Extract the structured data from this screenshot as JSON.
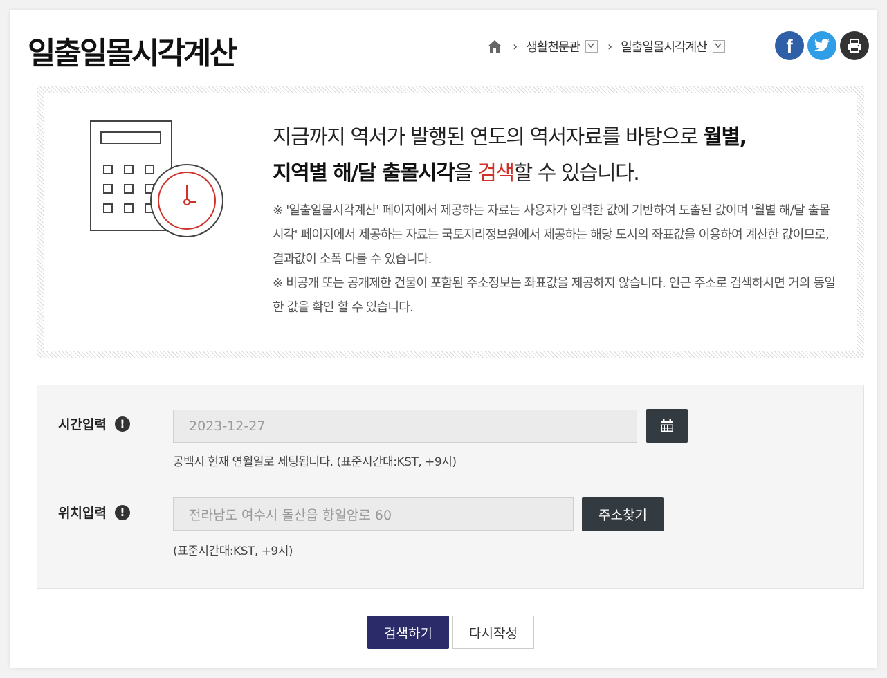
{
  "page": {
    "title": "일출일몰시각계산"
  },
  "breadcrumb": {
    "home_icon": "home-icon",
    "items": [
      {
        "label": "생활천문관"
      },
      {
        "label": "일출일몰시각계산"
      }
    ]
  },
  "social": {
    "facebook": {
      "icon": "facebook-icon",
      "label": "f",
      "color": "#2f5fa6"
    },
    "twitter": {
      "icon": "twitter-icon",
      "color": "#2f9ee6"
    },
    "print": {
      "icon": "print-icon",
      "color": "#333333"
    }
  },
  "info": {
    "lead_part1": "지금까지 역서가 발행된 연도의 역서자료를 바탕으로 ",
    "lead_bold1": "월별,",
    "lead_bold2": "지역별 해/달 출몰시각",
    "lead_part2": "을 ",
    "lead_red": "검색",
    "lead_part3": "할 수 있습니다.",
    "note1": "※ '일출일몰시각계산' 페이지에서 제공하는 자료는 사용자가 입력한 값에 기반하여 도출된 값이며 '월별 해/달 출몰시각' 페이지에서 제공하는 자료는 국토지리정보원에서 제공하는 해당 도시의 좌표값을 이용하여 계산한 값이므로, 결과값이 소폭 다를 수 있습니다.",
    "note2": "※ 비공개 또는 공개제한 건물이 포함된 주소정보는 좌표값을 제공하지 않습니다. 인근 주소로 검색하시면 거의 동일한 값을 확인 할 수 있습니다.",
    "accent_color": "#d0322b"
  },
  "form": {
    "time": {
      "label": "시간입력",
      "value": "2023-12-27",
      "hint": "공백시 현재 연월일로 세팅됩니다. (표준시간대:KST, +9시)",
      "calendar_icon": "calendar-icon",
      "warn_glyph": "!"
    },
    "location": {
      "label": "위치입력",
      "value": "전라남도 여수시 돌산읍 향일암로 60",
      "button": "주소찾기",
      "hint": "(표준시간대:KST, +9시)",
      "warn_glyph": "!"
    }
  },
  "actions": {
    "search": "검색하기",
    "reset": "다시작성",
    "search_color": "#2b2b6a"
  }
}
